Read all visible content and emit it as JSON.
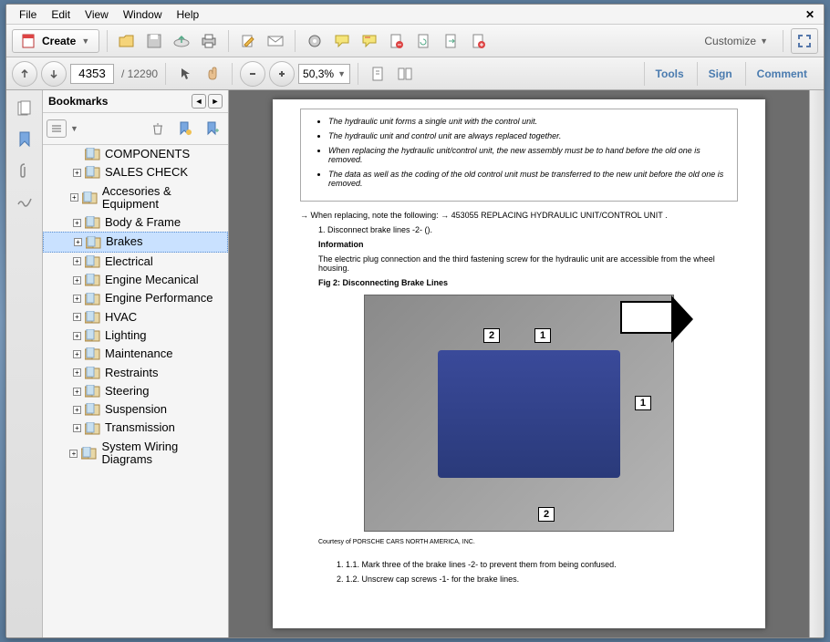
{
  "menubar": {
    "file": "File",
    "edit": "Edit",
    "view": "View",
    "window": "Window",
    "help": "Help"
  },
  "toolbar": {
    "create": "Create",
    "customize": "Customize"
  },
  "nav": {
    "page_current": "4353",
    "page_total": "/ 12290",
    "zoom": "50,3%"
  },
  "right_links": {
    "tools": "Tools",
    "sign": "Sign",
    "comment": "Comment"
  },
  "bookmarks": {
    "title": "Bookmarks",
    "items": [
      {
        "label": "COMPONENTS",
        "indent": 0,
        "expand": "",
        "selected": false
      },
      {
        "label": "SALES CHECK",
        "indent": 0,
        "expand": "+",
        "selected": false
      },
      {
        "label": "Accesories & Equipment",
        "indent": 0,
        "expand": "+",
        "selected": false
      },
      {
        "label": "Body & Frame",
        "indent": 0,
        "expand": "+",
        "selected": false
      },
      {
        "label": "Brakes",
        "indent": 0,
        "expand": "+",
        "selected": true
      },
      {
        "label": "Electrical",
        "indent": 0,
        "expand": "+",
        "selected": false
      },
      {
        "label": "Engine Mecanical",
        "indent": 0,
        "expand": "+",
        "selected": false
      },
      {
        "label": "Engine Performance",
        "indent": 0,
        "expand": "+",
        "selected": false
      },
      {
        "label": "HVAC",
        "indent": 0,
        "expand": "+",
        "selected": false
      },
      {
        "label": "Lighting",
        "indent": 0,
        "expand": "+",
        "selected": false
      },
      {
        "label": "Maintenance",
        "indent": 0,
        "expand": "+",
        "selected": false
      },
      {
        "label": "Restraints",
        "indent": 0,
        "expand": "+",
        "selected": false
      },
      {
        "label": "Steering",
        "indent": 0,
        "expand": "+",
        "selected": false
      },
      {
        "label": "Suspension",
        "indent": 0,
        "expand": "+",
        "selected": false
      },
      {
        "label": "Transmission",
        "indent": 0,
        "expand": "+",
        "selected": false
      },
      {
        "label": "System Wiring Diagrams",
        "indent": 0,
        "expand": "+",
        "selected": false
      }
    ]
  },
  "doc": {
    "bullets": [
      "The hydraulic unit forms a single unit with the control unit.",
      "The hydraulic unit and control unit are always replaced together.",
      "When replacing the hydraulic unit/control unit, the new assembly must be to hand before the old one is removed.",
      "The data as well as the coding of the old control unit must be transferred to the new unit before the old one is removed."
    ],
    "replace_note": "→ When replacing, note the following: → 453055 REPLACING HYDRAULIC UNIT/CONTROL UNIT .",
    "step1": "1. Disconnect brake lines -2-  ().",
    "info_head": "Information",
    "info_text": "The electric plug connection and the third fastening screw for the hydraulic unit are accessible from the wheel housing.",
    "fig_caption": "Fig 2: Disconnecting Brake Lines",
    "courtesy": "Courtesy of PORSCHE CARS NORTH AMERICA, INC.",
    "step11": "1. 1.1. Mark three of the brake lines -2-  to prevent them from being confused.",
    "step12": "2. 1.2. Unscrew cap screws -1-  for the brake lines."
  }
}
